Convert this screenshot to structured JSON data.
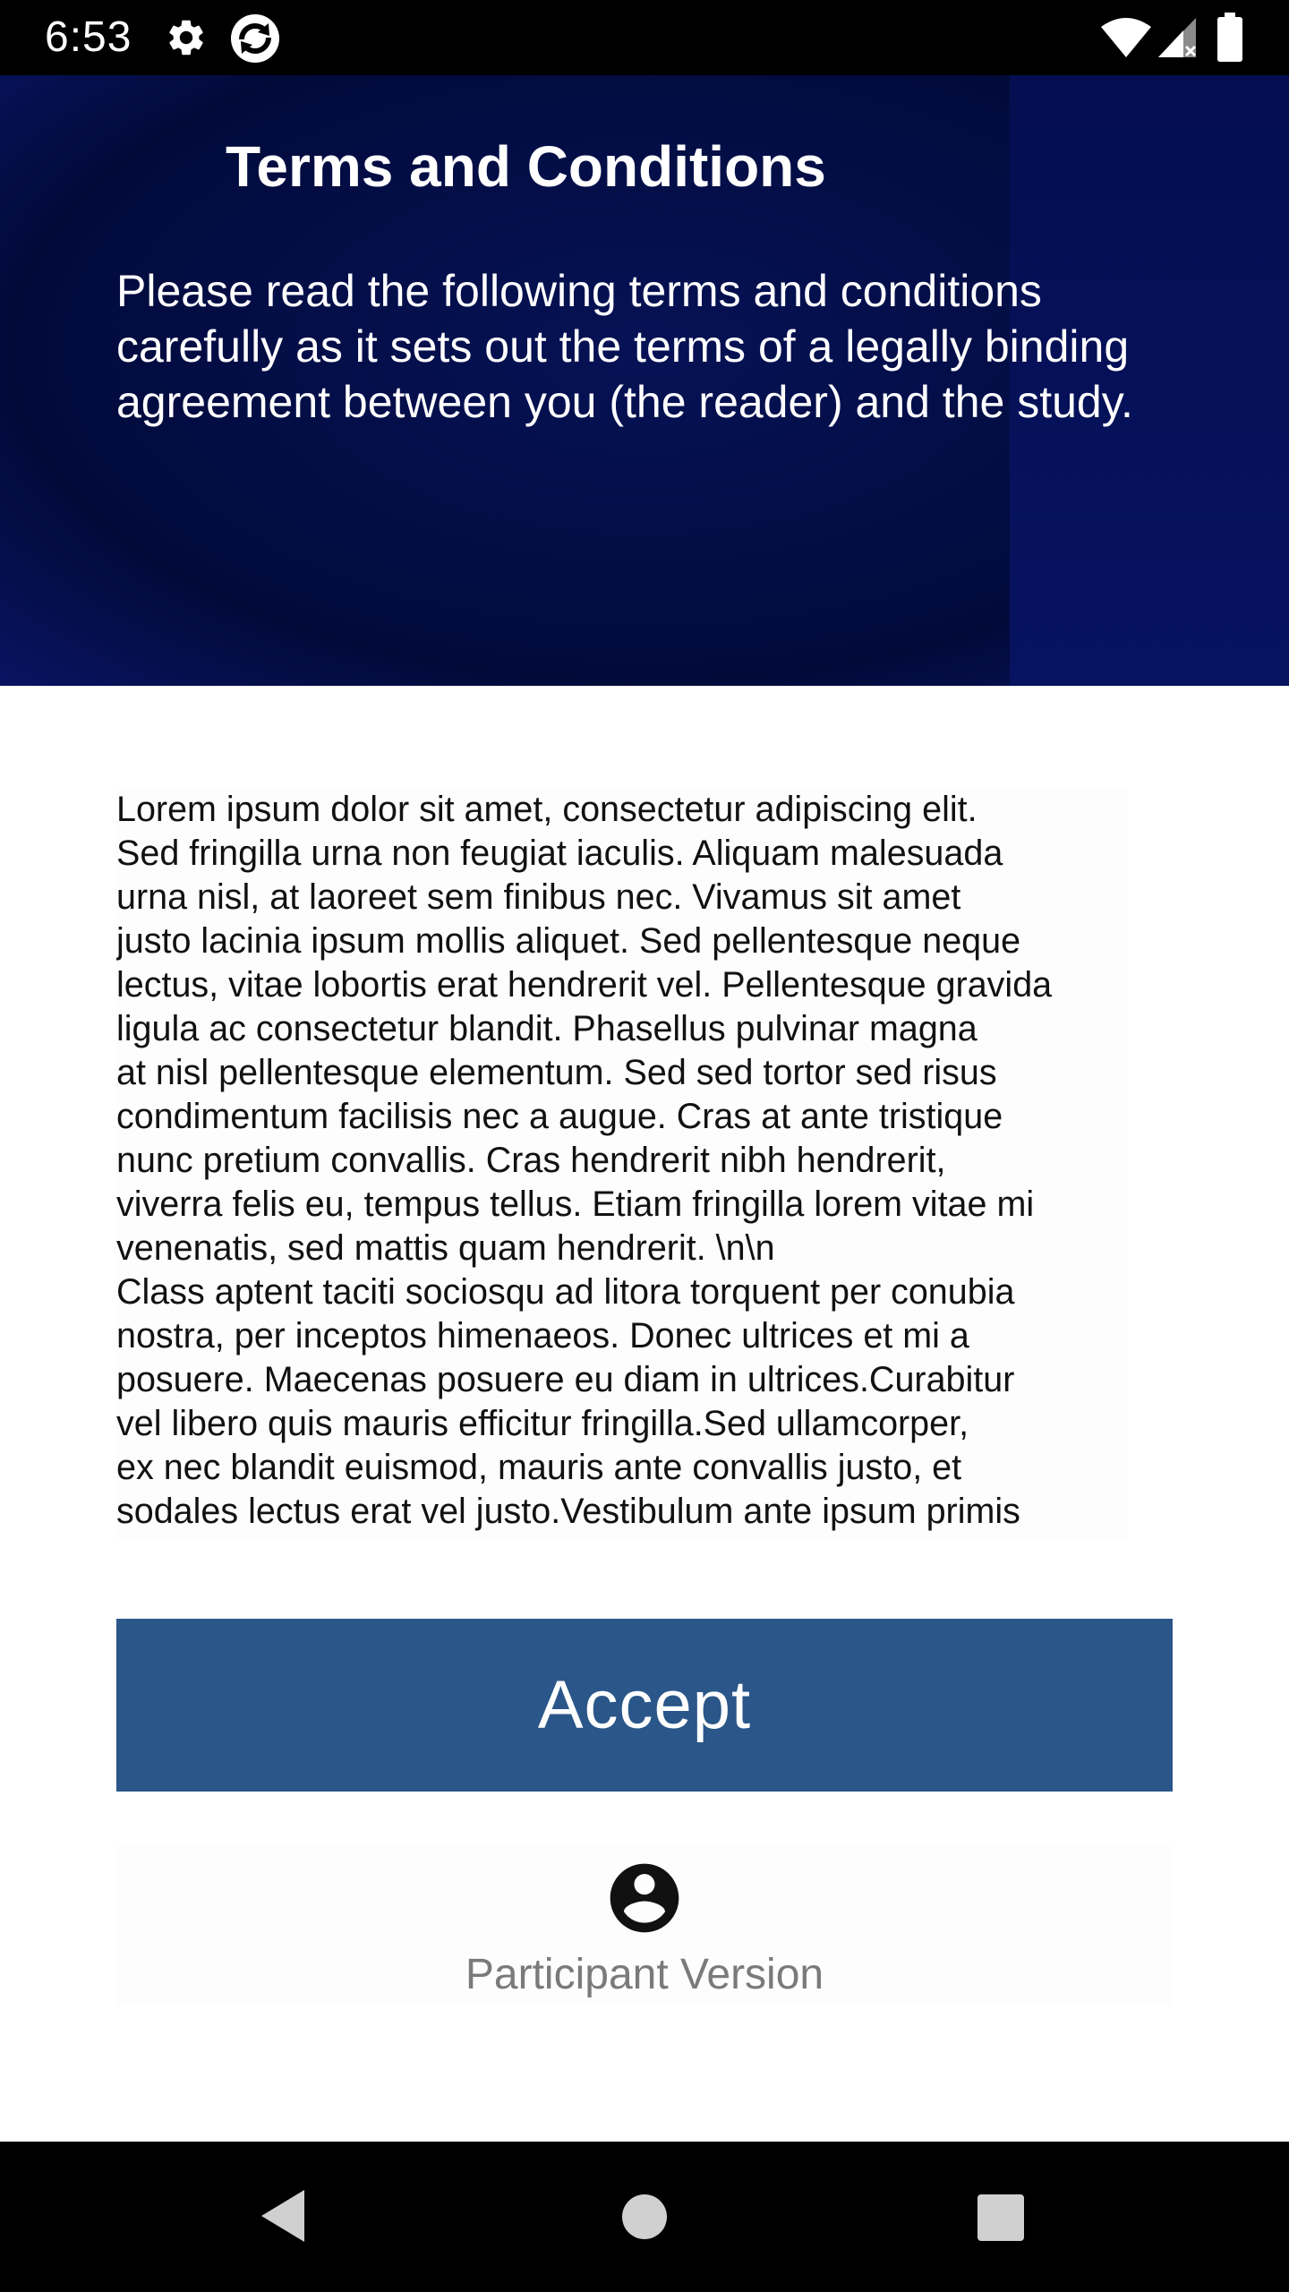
{
  "status_bar": {
    "time": "6:53",
    "icons": [
      "settings-icon",
      "sync-icon",
      "wifi-icon",
      "signal-icon",
      "battery-icon"
    ]
  },
  "header": {
    "title": "Terms and Conditions",
    "subtitle": "Please read the following terms and conditions carefully as it sets out the terms of a legally binding agreement between you (the reader) and the study.",
    "background_color": "#030d45"
  },
  "terms": {
    "text": "Lorem ipsum dolor sit amet, consectetur adipiscing elit.\nSed fringilla urna non feugiat iaculis. Aliquam malesuada\nurna nisl, at laoreet sem finibus nec. Vivamus sit amet\njusto lacinia ipsum mollis aliquet. Sed pellentesque neque\nlectus, vitae lobortis erat hendrerit vel. Pellentesque gravida\nligula ac consectetur blandit. Phasellus pulvinar magna\nat nisl pellentesque elementum. Sed sed tortor sed risus\ncondimentum facilisis nec a augue. Cras at ante tristique\nnunc pretium convallis. Cras hendrerit nibh hendrerit,\nviverra felis eu, tempus tellus. Etiam fringilla lorem vitae mi\nvenenatis, sed mattis quam hendrerit. \\n\\n\nClass aptent taciti sociosqu ad litora torquent per conubia\nnostra, per inceptos himenaeos. Donec ultrices et mi a\nposuere. Maecenas posuere eu diam in ultrices.Curabitur\nvel libero quis mauris efficitur fringilla.Sed ullamcorper,\nex nec blandit euismod, mauris ante convallis justo, et\nsodales lectus erat vel justo.Vestibulum ante ipsum primis"
  },
  "accept_button": {
    "label": "Accept",
    "color": "#2a5689"
  },
  "participant": {
    "icon": "account-circle-icon",
    "label": "Participant Version"
  },
  "nav_bar": {
    "buttons": [
      "back-icon",
      "home-icon",
      "recents-icon"
    ]
  }
}
